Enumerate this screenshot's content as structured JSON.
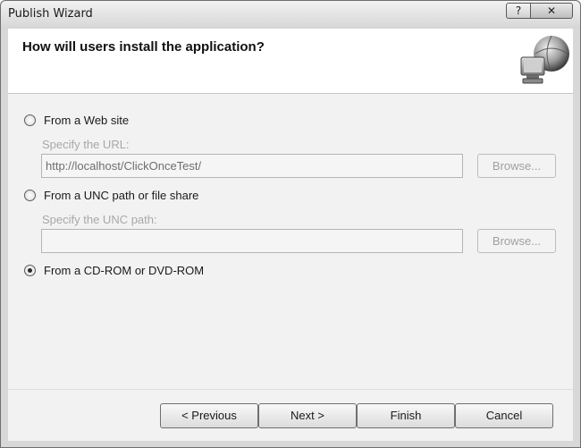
{
  "window": {
    "title": "Publish Wizard",
    "help_glyph": "?",
    "close_glyph": "✕"
  },
  "header": {
    "title": "How will users install the application?",
    "icon": "globe-computer-icon"
  },
  "options": {
    "web": {
      "label": "From a Web site",
      "selected": false,
      "sub_label": "Specify the URL:",
      "value": "http://localhost/ClickOnceTest/",
      "browse_label": "Browse..."
    },
    "unc": {
      "label": "From a UNC path or file share",
      "selected": false,
      "sub_label": "Specify the UNC path:",
      "value": "",
      "browse_label": "Browse..."
    },
    "cd": {
      "label": "From a CD-ROM or DVD-ROM",
      "selected": true
    }
  },
  "buttons": {
    "previous": "< Previous",
    "next": "Next >",
    "finish": "Finish",
    "cancel": "Cancel"
  }
}
